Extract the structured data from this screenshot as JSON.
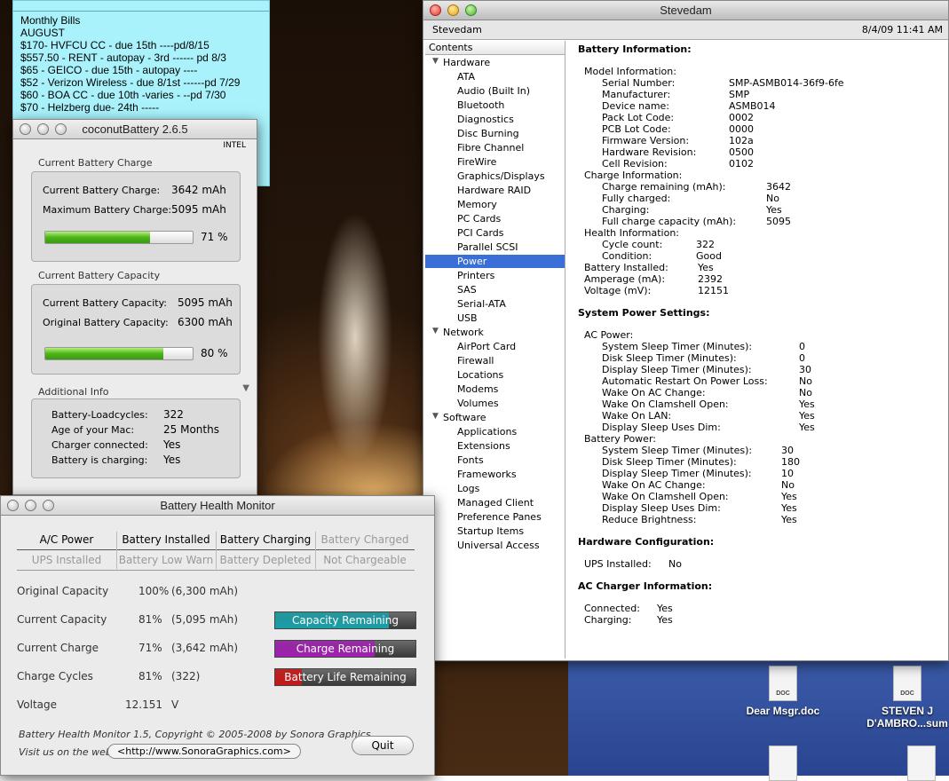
{
  "sticky": {
    "lines": [
      "Monthly Bills",
      "AUGUST",
      "$170- HVFCU CC - due 15th ----pd/8/15",
      "$557.50 - RENT - autopay - 3rd ------ pd 8/3",
      "$65 - GEICO - due 15th - autopay  ----",
      "$52 - Verizon Wireless - due 8/1st   ------pd 7/29",
      "$60 - BOA CC - due 10th -varies - --pd 7/30",
      "$70 - Helzberg due- 24th -----"
    ]
  },
  "desktop": {
    "icons": [
      {
        "name": "Dear Msgr.doc",
        "badge": "DOC"
      },
      {
        "name": "STEVEN J D'AMBRO...sum",
        "badge": "DOC"
      }
    ]
  },
  "coconut": {
    "title": "coconutBattery 2.6.5",
    "intel": "INTEL",
    "charge_title": "Current Battery Charge",
    "current_charge_label": "Current Battery Charge:",
    "current_charge": "3642 mAh",
    "max_charge_label": "Maximum Battery Charge:",
    "max_charge": "5095 mAh",
    "charge_pct": "71 %",
    "charge_frac": 0.71,
    "capacity_title": "Current Battery Capacity",
    "current_capacity_label": "Current Battery Capacity:",
    "current_capacity": "5095 mAh",
    "original_capacity_label": "Original Battery Capacity:",
    "original_capacity": "6300 mAh",
    "capacity_pct": "80 %",
    "capacity_frac": 0.8,
    "addl_title": "Additional Info",
    "info": [
      {
        "label": "Battery-Loadcycles:",
        "value": "322"
      },
      {
        "label": "Age of your Mac:",
        "value": "25 Months"
      },
      {
        "label": "Charger connected:",
        "value": "Yes"
      },
      {
        "label": "Battery is charging:",
        "value": "Yes"
      }
    ]
  },
  "bhm": {
    "title": "Battery Health Monitor",
    "status_row1": [
      "A/C Power",
      "Battery Installed",
      "Battery Charging",
      "Battery Charged"
    ],
    "status_row2": [
      "UPS Installed",
      "Battery Low Warn",
      "Battery Depleted",
      "Not Chargeable"
    ],
    "rows": [
      {
        "label": "Original Capacity",
        "pct": "100%",
        "detail": "(6,300 mAh)"
      },
      {
        "label": "Current Capacity",
        "pct": "81%",
        "detail": "(5,095 mAh)"
      },
      {
        "label": "Current Charge",
        "pct": "71%",
        "detail": "(3,642 mAh)"
      },
      {
        "label": "Charge Cycles",
        "pct": "81%",
        "detail": "(322)"
      },
      {
        "label": "Voltage",
        "pct": "12.151",
        "detail": "V"
      }
    ],
    "bars": [
      {
        "label": "Capacity Remaining",
        "frac": 0.81,
        "color": "#1aa0a8"
      },
      {
        "label": "Charge Remaining",
        "frac": 0.71,
        "color": "#a020b0"
      },
      {
        "label": "Battery Life Remaining",
        "frac": 0.19,
        "color": "#c81818"
      }
    ],
    "credit": "Battery Health Monitor 1.5, Copyright © 2005-2008 by Sonora Graphics",
    "visit": "Visit us on the web",
    "url": "<http://www.SonoraGraphics.com>",
    "quit": "Quit"
  },
  "profiler": {
    "title": "Stevedam",
    "machine": "Stevedam",
    "datetime": "8/4/09 11:41 AM",
    "contents": "Contents",
    "tree": [
      {
        "label": "Hardware",
        "level": 0
      },
      {
        "label": "ATA",
        "level": 1
      },
      {
        "label": "Audio (Built In)",
        "level": 1
      },
      {
        "label": "Bluetooth",
        "level": 1
      },
      {
        "label": "Diagnostics",
        "level": 1
      },
      {
        "label": "Disc Burning",
        "level": 1
      },
      {
        "label": "Fibre Channel",
        "level": 1
      },
      {
        "label": "FireWire",
        "level": 1
      },
      {
        "label": "Graphics/Displays",
        "level": 1
      },
      {
        "label": "Hardware RAID",
        "level": 1
      },
      {
        "label": "Memory",
        "level": 1
      },
      {
        "label": "PC Cards",
        "level": 1
      },
      {
        "label": "PCI Cards",
        "level": 1
      },
      {
        "label": "Parallel SCSI",
        "level": 1
      },
      {
        "label": "Power",
        "level": 1,
        "selected": true
      },
      {
        "label": "Printers",
        "level": 1
      },
      {
        "label": "SAS",
        "level": 1
      },
      {
        "label": "Serial-ATA",
        "level": 1
      },
      {
        "label": "USB",
        "level": 1
      },
      {
        "label": "Network",
        "level": 0
      },
      {
        "label": "AirPort Card",
        "level": 1
      },
      {
        "label": "Firewall",
        "level": 1
      },
      {
        "label": "Locations",
        "level": 1
      },
      {
        "label": "Modems",
        "level": 1
      },
      {
        "label": "Volumes",
        "level": 1
      },
      {
        "label": "Software",
        "level": 0
      },
      {
        "label": "Applications",
        "level": 1
      },
      {
        "label": "Extensions",
        "level": 1
      },
      {
        "label": "Fonts",
        "level": 1
      },
      {
        "label": "Frameworks",
        "level": 1
      },
      {
        "label": "Logs",
        "level": 1
      },
      {
        "label": "Managed Client",
        "level": 1
      },
      {
        "label": "Preference Panes",
        "level": 1
      },
      {
        "label": "Startup Items",
        "level": 1
      },
      {
        "label": "Universal Access",
        "level": 1
      }
    ],
    "detail": [
      {
        "t": "Battery Information:",
        "b": true,
        "i": 0,
        "gap": 0
      },
      {
        "t": "Model Information:",
        "i": 1,
        "gap": 1
      },
      {
        "t": "Serial Number:",
        "v": "SMP-ASMB014-36f9-6fe",
        "i": 2,
        "vx": 2
      },
      {
        "t": "Manufacturer:",
        "v": "SMP",
        "i": 2,
        "vx": 2
      },
      {
        "t": "Device name:",
        "v": "ASMB014",
        "i": 2,
        "vx": 2
      },
      {
        "t": "Pack Lot Code:",
        "v": "0002",
        "i": 2,
        "vx": 2
      },
      {
        "t": "PCB Lot Code:",
        "v": "0000",
        "i": 2,
        "vx": 2
      },
      {
        "t": "Firmware Version:",
        "v": "102a",
        "i": 2,
        "vx": 2
      },
      {
        "t": "Hardware Revision:",
        "v": "0500",
        "i": 2,
        "vx": 2
      },
      {
        "t": "Cell Revision:",
        "v": "0102",
        "i": 2,
        "vx": 2
      },
      {
        "t": "Charge Information:",
        "i": 1
      },
      {
        "t": "Charge remaining (mAh):",
        "v": "3642",
        "i": 2,
        "vx": 3
      },
      {
        "t": "Fully charged:",
        "v": "No",
        "i": 2,
        "vx": 3
      },
      {
        "t": "Charging:",
        "v": "Yes",
        "i": 2,
        "vx": 3
      },
      {
        "t": "Full charge capacity (mAh):",
        "v": "5095",
        "i": 2,
        "vx": 3
      },
      {
        "t": "Health Information:",
        "i": 1
      },
      {
        "t": "Cycle count:",
        "v": "322",
        "i": 2,
        "vx": 4
      },
      {
        "t": "Condition:",
        "v": "Good",
        "i": 2,
        "vx": 5
      },
      {
        "t": "Battery Installed:",
        "v": "Yes",
        "i": 1,
        "vx": 6
      },
      {
        "t": "Amperage (mA):",
        "v": "2392",
        "i": 1,
        "vx": 6
      },
      {
        "t": "Voltage (mV):",
        "v": "12151",
        "i": 1,
        "vx": 6
      },
      {
        "t": "System Power Settings:",
        "b": true,
        "i": 0,
        "gap": 1
      },
      {
        "t": "AC Power:",
        "i": 1,
        "gap": 1
      },
      {
        "t": "System Sleep Timer (Minutes):",
        "v": "0",
        "i": 2,
        "vx": 7
      },
      {
        "t": "Disk Sleep Timer (Minutes):",
        "v": "0",
        "i": 2,
        "vx": 7
      },
      {
        "t": "Display Sleep Timer (Minutes):",
        "v": "30",
        "i": 2,
        "vx": 7
      },
      {
        "t": "Automatic Restart On Power Loss:",
        "v": "No",
        "i": 2,
        "vx": 7
      },
      {
        "t": "Wake On AC Change:",
        "v": "No",
        "i": 2,
        "vx": 7
      },
      {
        "t": "Wake On Clamshell Open:",
        "v": "Yes",
        "i": 2,
        "vx": 7
      },
      {
        "t": "Wake On LAN:",
        "v": "Yes",
        "i": 2,
        "vx": 7
      },
      {
        "t": "Display Sleep Uses Dim:",
        "v": "Yes",
        "i": 2,
        "vx": 7
      },
      {
        "t": "Battery Power:",
        "i": 1
      },
      {
        "t": "System Sleep Timer (Minutes):",
        "v": "30",
        "i": 2,
        "vx": 8
      },
      {
        "t": "Disk Sleep Timer (Minutes):",
        "v": "180",
        "i": 2,
        "vx": 8
      },
      {
        "t": "Display Sleep Timer (Minutes):",
        "v": "10",
        "i": 2,
        "vx": 8
      },
      {
        "t": "Wake On AC Change:",
        "v": "No",
        "i": 2,
        "vx": 8
      },
      {
        "t": "Wake On Clamshell Open:",
        "v": "Yes",
        "i": 2,
        "vx": 8
      },
      {
        "t": "Display Sleep Uses Dim:",
        "v": "Yes",
        "i": 2,
        "vx": 8
      },
      {
        "t": "Reduce Brightness:",
        "v": "Yes",
        "i": 2,
        "vx": 8
      },
      {
        "t": "Hardware Configuration:",
        "b": true,
        "i": 0,
        "gap": 1
      },
      {
        "t": "UPS Installed:",
        "v": "No",
        "i": 1,
        "vx": 9,
        "gap": 1
      },
      {
        "t": "AC Charger Information:",
        "b": true,
        "i": 0,
        "gap": 1
      },
      {
        "t": "Connected:",
        "v": "Yes",
        "i": 1,
        "vx": 10,
        "gap": 1
      },
      {
        "t": "Charging:",
        "v": "Yes",
        "i": 1,
        "vx": 10
      }
    ]
  }
}
